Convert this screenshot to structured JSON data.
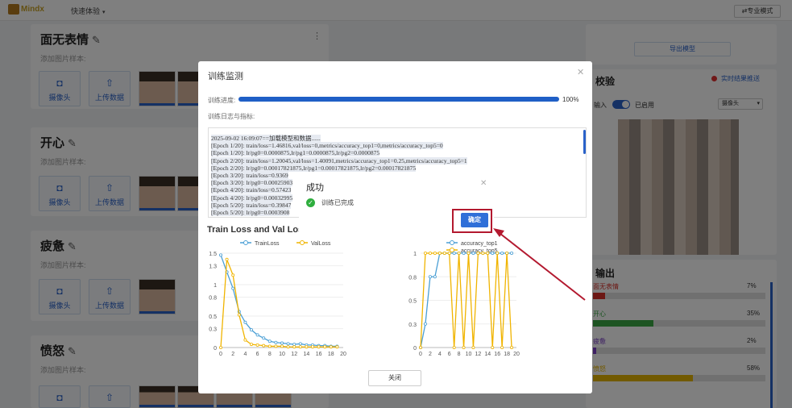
{
  "header": {
    "logo": "Mindx",
    "experience": "快速体验",
    "pro_mode": "专业模式"
  },
  "cards": [
    {
      "title": "面无表情",
      "sample_label": "添加图片样本:"
    },
    {
      "title": "开心",
      "sample_label": "添加图片样本:"
    },
    {
      "title": "疲惫",
      "sample_label": "添加图片样本:"
    },
    {
      "title": "愤怒",
      "sample_label": "添加图片样本:"
    }
  ],
  "tiles": {
    "camera": "摄像头",
    "upload": "上传数据"
  },
  "right_panel": {
    "export_button": "导出模型",
    "preview_title": "校验",
    "realtime_link": "实时结果推送",
    "input_label": "输入",
    "toggle_label": "已启用",
    "source_select": "摄像头",
    "output_title": "输出",
    "outputs": [
      {
        "label": "面无表情",
        "value": "7%",
        "fraction": 0.07,
        "color": "#d9312b"
      },
      {
        "label": "开心",
        "value": "35%",
        "fraction": 0.35,
        "color": "#3aa845"
      },
      {
        "label": "疲惫",
        "value": "2%",
        "fraction": 0.02,
        "color": "#7b3fc6"
      },
      {
        "label": "愤怒",
        "value": "58%",
        "fraction": 0.58,
        "color": "#e5b400"
      }
    ]
  },
  "dialog": {
    "title": "训练监测",
    "progress_label": "训练进度:",
    "progress_fraction": 1.0,
    "progress_text": "100%",
    "log_label": "训练日志与指标:",
    "log_lines": [
      "2025-09-02 16:09:07==加载模型和数据......",
      "[Epoch 1/20]: train/loss=1.46816,val/loss=0,metrics/accuracy_top1=0,metrics/accuracy_top5=0",
      "[Epoch 1/20]: lr/pg0=0.0000875,lr/pg1=0.0000875,lr/pg2=0.0000875",
      "[Epoch 2/20]: train/loss=1.20045,val/loss=1.40091,metrics/accuracy_top1=0.25,metrics/accuracy_top5=1",
      "[Epoch 2/20]: lr/pg0=0.00017821875,lr/pg1=0.00017821875,lr/pg2=0.00017821875",
      "[Epoch 3/20]: train/loss=0.9369",
      "[Epoch 3/20]: lr/pg0=0.00025903",
      "[Epoch 4/20]: train/loss=0.57423",
      "[Epoch 4/20]: lr/pg0=0.00032995",
      "[Epoch 5/20]: train/loss=0.39847",
      "[Epoch 5/20]: lr/pg0=0.0003908"
    ],
    "close_button": "关闭"
  },
  "success_dialog": {
    "title": "成功",
    "message": "训练已完成",
    "ok_button": "确定"
  },
  "chart_data": [
    {
      "type": "line",
      "title": "Train Loss and Val Los",
      "x": [
        0,
        1,
        2,
        3,
        4,
        5,
        6,
        7,
        8,
        9,
        10,
        11,
        12,
        13,
        14,
        15,
        16,
        17,
        18,
        19
      ],
      "series": [
        {
          "name": "TrainLoss",
          "color": "#4a9fd5",
          "values": [
            1.47,
            1.2,
            0.94,
            0.57,
            0.4,
            0.28,
            0.2,
            0.15,
            0.1,
            0.08,
            0.07,
            0.06,
            0.05,
            0.06,
            0.04,
            0.04,
            0.03,
            0.03,
            0.02,
            0.02
          ]
        },
        {
          "name": "ValLoss",
          "color": "#f0b400",
          "values": [
            0,
            1.4,
            1.15,
            0.52,
            0.12,
            0.05,
            0.04,
            0.03,
            0.02,
            0.02,
            0.02,
            0.01,
            0.01,
            0.01,
            0.01,
            0.01,
            0.01,
            0.01,
            0.01,
            0.01
          ]
        }
      ],
      "xlim": [
        0,
        20
      ],
      "ylim": [
        0,
        1.5
      ],
      "xticks": [
        0,
        2,
        4,
        6,
        8,
        10,
        12,
        14,
        16,
        18,
        20
      ],
      "yticks": [
        0,
        0.3,
        0.5,
        0.8,
        1,
        1.3,
        1.5
      ],
      "yticklabels": [
        "0",
        "0.3",
        "0.5",
        "0.8",
        "1",
        "1.3",
        "1.5"
      ],
      "legend": "top"
    },
    {
      "type": "line",
      "title": "",
      "x": [
        0,
        1,
        2,
        3,
        4,
        5,
        6,
        7,
        8,
        9,
        10,
        11,
        12,
        13,
        14,
        15,
        16,
        17,
        18,
        19
      ],
      "series": [
        {
          "name": "accuracy_top1",
          "color": "#4a9fd5",
          "values": [
            0,
            0.25,
            0.75,
            0.75,
            1,
            1,
            1,
            1,
            1,
            1,
            1,
            1,
            1,
            1,
            1,
            1,
            1,
            1,
            1,
            1
          ]
        },
        {
          "name": "accuracy_top5",
          "color": "#f0b400",
          "values": [
            0,
            1,
            1,
            1,
            1,
            1,
            1,
            0,
            1,
            0,
            1,
            0,
            1,
            1,
            1,
            0,
            1,
            0,
            1,
            0
          ]
        }
      ],
      "xlim": [
        0,
        20
      ],
      "ylim": [
        0,
        1
      ],
      "xticks": [
        0,
        2,
        4,
        6,
        8,
        10,
        12,
        14,
        16,
        18,
        20
      ],
      "yticks": [
        0,
        0.25,
        0.5,
        0.75,
        1
      ],
      "yticklabels": [
        "0",
        "0.3",
        "0.5",
        "0.8",
        "1"
      ],
      "legend": "top"
    }
  ]
}
